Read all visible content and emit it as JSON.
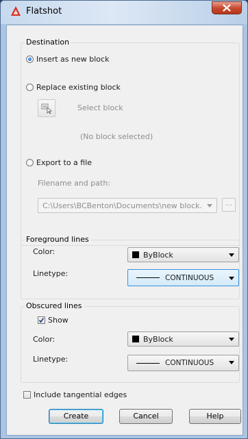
{
  "window": {
    "title": "Flatshot"
  },
  "destination": {
    "label": "Destination",
    "insert_label": "Insert as new block",
    "replace_label": "Replace existing block",
    "select_block_label": "Select block",
    "no_block_label": "(No block selected)",
    "export_label": "Export to a file",
    "filename_label": "Filename and path:",
    "path_value": "C:\\Users\\BCBenton\\Documents\\new block.",
    "browse_label": "..."
  },
  "foreground": {
    "label": "Foreground lines",
    "color_label": "Color:",
    "color_value": "ByBlock",
    "linetype_label": "Linetype:",
    "linetype_value": "CONTINUOUS"
  },
  "obscured": {
    "label": "Obscured lines",
    "show_label": "Show",
    "show_checked": true,
    "color_label": "Color:",
    "color_value": "ByBlock",
    "linetype_label": "Linetype:",
    "linetype_value": "CONTINUOUS"
  },
  "tangential": {
    "label": "Include tangential edges",
    "checked": false
  },
  "buttons": {
    "create": "Create",
    "cancel": "Cancel",
    "help": "Help"
  },
  "colors": {
    "title_bg": "#c9dbee",
    "close_red": "#c84b31",
    "focus_blue": "#3c8fd8",
    "dialog_bg": "#f0f0f0"
  }
}
